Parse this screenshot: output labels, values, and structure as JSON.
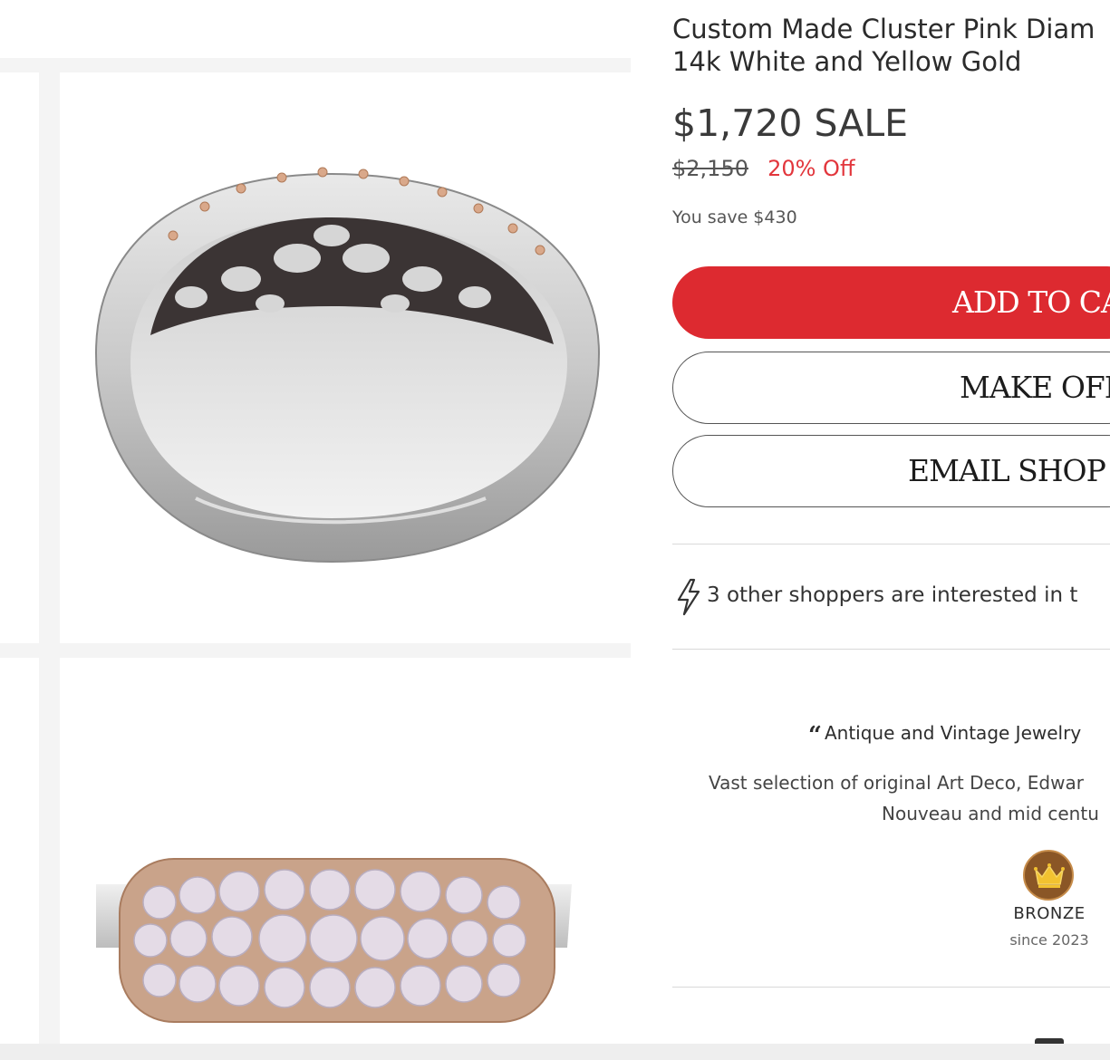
{
  "product": {
    "title_line1": "Custom Made Cluster Pink Diam",
    "title_line2": "14k White and Yellow Gold",
    "price": "$1,720 SALE",
    "original_price": "$2,150",
    "discount": "20% Off",
    "savings": "You save $430"
  },
  "actions": {
    "add_to_cart": "ADD TO CA",
    "make_offer": "MAKE OFF",
    "email_shop": "EMAIL SHOP OV"
  },
  "activity": {
    "interest_text": "3 other shoppers are interested in t",
    "icon": "lightning-icon"
  },
  "shop": {
    "quote_mark": "“",
    "tagline": "Antique and Vintage Jewelry",
    "description_line1": "Vast selection of original Art Deco, Edwar",
    "description_line2": "Nouveau and mid centu",
    "badge_level": "BRONZE",
    "badge_since": "since 2023",
    "badge_icon": "crown-icon"
  },
  "gallery": {
    "images": [
      "ring-back-view-image",
      "ring-top-view-image"
    ]
  },
  "colors": {
    "accent_red": "#dd2a30",
    "discount_red": "#e2363c",
    "badge_bronze": "#8a5626",
    "badge_crown": "#f2c230"
  }
}
